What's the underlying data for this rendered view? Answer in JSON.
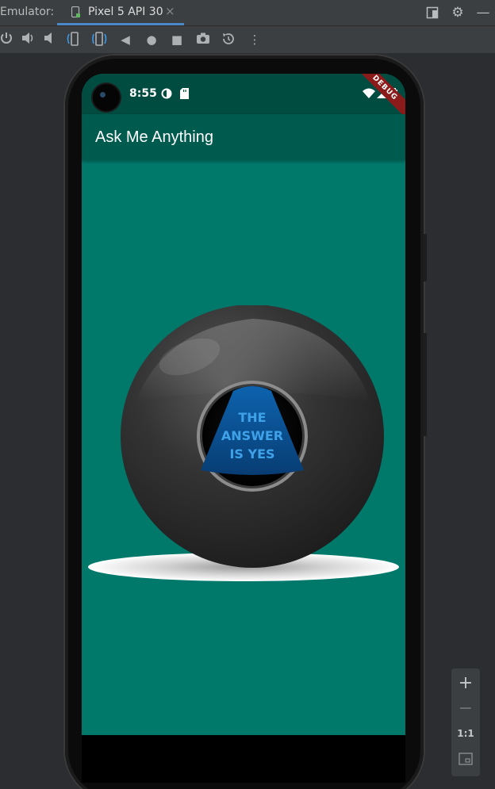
{
  "ide": {
    "section_label": "Emulator:",
    "tab_label": "Pixel 5 API 30",
    "tab_close": "×",
    "icons": {
      "tab_device": "phone-icon",
      "restore": "window-restore-icon",
      "settings": "gear-icon",
      "minimize": "minimize-icon"
    }
  },
  "toolbar": {
    "buttons": [
      {
        "name": "power-icon",
        "glyph": "⏻"
      },
      {
        "name": "volume-up-icon",
        "glyph": "🔊"
      },
      {
        "name": "volume-down-icon",
        "glyph": "🔉"
      },
      {
        "name": "rotate-left-icon",
        "glyph": "⟲"
      },
      {
        "name": "rotate-right-icon",
        "glyph": "⟳"
      },
      {
        "name": "back-icon",
        "glyph": "◀"
      },
      {
        "name": "home-icon",
        "glyph": "●"
      },
      {
        "name": "overview-icon",
        "glyph": "■"
      },
      {
        "name": "camera-icon",
        "glyph": "📷"
      },
      {
        "name": "snapshot-icon",
        "glyph": "↺"
      },
      {
        "name": "more-icon",
        "glyph": "⋮"
      }
    ]
  },
  "device": {
    "status_time": "8:55",
    "debug_label": "DEBUG",
    "app_title": "Ask Me Anything",
    "ball_answer_lines": [
      "THE",
      "ANSWER",
      "IS YES"
    ],
    "colors": {
      "app_background": "#00796b",
      "app_bar": "#005b4f",
      "status_bar": "#004c40",
      "answer_triangle": "#0a5ea8",
      "answer_text": "#3fa2e8"
    }
  },
  "zoom": {
    "zoom_in": "+",
    "zoom_out": "−",
    "actual_size": "1:1"
  }
}
